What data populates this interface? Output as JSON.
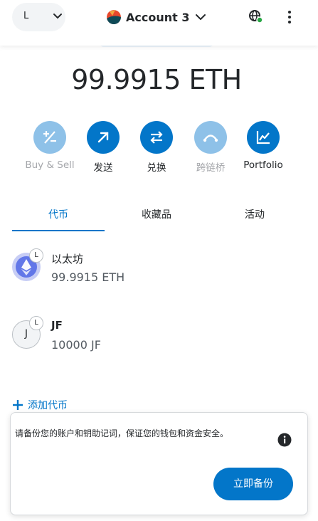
{
  "header": {
    "network_letter": "L",
    "account_name": "Account 3"
  },
  "balance": "99.9915 ETH",
  "actions": [
    {
      "label": "Buy & Sell",
      "enabled": false
    },
    {
      "label": "发送",
      "enabled": true
    },
    {
      "label": "兑换",
      "enabled": true
    },
    {
      "label": "跨链桥",
      "enabled": false
    },
    {
      "label": "Portfolio",
      "enabled": true
    }
  ],
  "tabs": [
    {
      "label": "代币",
      "active": true
    },
    {
      "label": "收藏品",
      "active": false
    },
    {
      "label": "活动",
      "active": false
    }
  ],
  "tokens": [
    {
      "name": "以太坊",
      "balance": "99.9915 ETH",
      "icon": "ethereum-icon",
      "badge": "L"
    },
    {
      "name": "JF",
      "balance": "10000 JF",
      "icon_letter": "J",
      "badge": "L"
    }
  ],
  "add_token_label": "添加代币",
  "backup_banner": {
    "text": "请备份您的账户和钥助记词，保证您的钱包和资金安全。",
    "button_label": "立即备份"
  },
  "colors": {
    "accent": "#0376c9",
    "accent_disabled": "#8ec1e8",
    "text": "#24272a",
    "muted": "#a5a7ab"
  }
}
